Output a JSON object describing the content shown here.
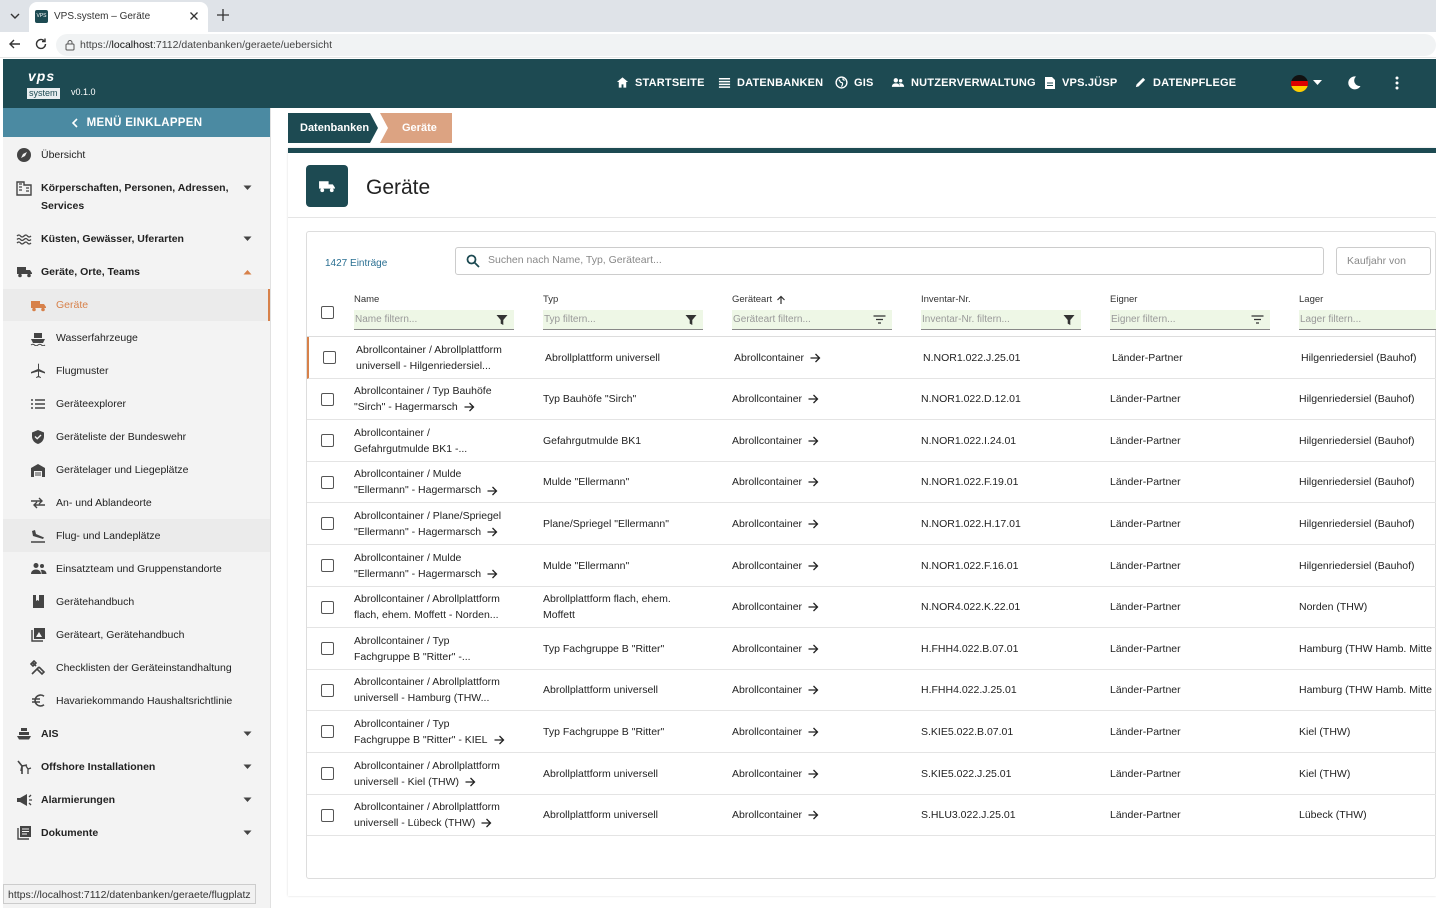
{
  "browser": {
    "tab_title": "VPS.system – Geräte",
    "favicon_text": "VPS",
    "url_prefix": "https://",
    "url_host": "localhost",
    "url_rest": ":7112/datenbanken/geraete/uebersicht",
    "status_url": "https://localhost:7112/datenbanken/geraete/flugplatz"
  },
  "app": {
    "logo_top": "vps",
    "logo_bottom": "system",
    "version": "v0.1.0",
    "brand_color": "#1d4a52",
    "accent_color": "#d7814a",
    "nav": [
      {
        "label": "STARTSEITE",
        "icon": "home-icon"
      },
      {
        "label": "DATENBANKEN",
        "icon": "list-icon"
      },
      {
        "label": "GIS",
        "icon": "globe-icon"
      },
      {
        "label": "NUTZERVERWALTUNG",
        "icon": "users-icon"
      },
      {
        "label": "VPS.JÜSP",
        "icon": "document-icon"
      },
      {
        "label": "DATENPFLEGE",
        "icon": "pencil-icon"
      }
    ]
  },
  "sidebar": {
    "collapse_label": "MENÜ EINKLAPPEN",
    "items": [
      {
        "label": "Übersicht",
        "icon": "compass-icon"
      },
      {
        "label": "Körperschaften, Personen, Adressen,",
        "label2": "Services",
        "icon": "building-icon"
      },
      {
        "label": "Küsten, Gewässer, Uferarten",
        "icon": "waves-icon"
      },
      {
        "label": "Geräte, Orte, Teams",
        "icon": "truck-icon"
      },
      {
        "label": "Geräte",
        "icon": "truck-icon"
      },
      {
        "label": "Wasserfahrzeuge",
        "icon": "boat-icon"
      },
      {
        "label": "Flugmuster",
        "icon": "plane-icon"
      },
      {
        "label": "Geräteexplorer",
        "icon": "list-icon"
      },
      {
        "label": "Geräteliste der Bundeswehr",
        "icon": "shield-icon"
      },
      {
        "label": "Gerätelager und Liegeplätze",
        "icon": "warehouse-icon"
      },
      {
        "label": "An- und Ablandeorte",
        "icon": "transfer-icon"
      },
      {
        "label": "Flug- und Landeplätze",
        "icon": "landing-icon"
      },
      {
        "label": "Einsatzteam und Gruppenstandorte",
        "icon": "group-icon"
      },
      {
        "label": "Gerätehandbuch",
        "icon": "book-icon"
      },
      {
        "label": "Geräteart, Gerätehandbuch",
        "icon": "image-book-icon"
      },
      {
        "label": "Checklisten der Geräteinstandhaltung",
        "icon": "tools-icon"
      },
      {
        "label": "Havariekommando Haushaltsrichtlinie",
        "icon": "euro-icon"
      },
      {
        "label": "AIS",
        "icon": "ship-icon"
      },
      {
        "label": "Offshore Installationen",
        "icon": "windfarm-icon"
      },
      {
        "label": "Alarmierungen",
        "icon": "megaphone-icon"
      },
      {
        "label": "Dokumente",
        "icon": "documents-icon"
      }
    ]
  },
  "breadcrumb": {
    "root": "Datenbanken",
    "current": "Geräte"
  },
  "page": {
    "title": "Geräte"
  },
  "table": {
    "count": "1427 Einträge",
    "search_placeholder": "Suchen nach Name, Typ, Geräteart...",
    "year_placeholder": "Kaufjahr von",
    "columns": [
      {
        "label": "Name",
        "filter": "Name filtern..."
      },
      {
        "label": "Typ",
        "filter": "Typ filtern..."
      },
      {
        "label": "Geräteart",
        "filter": "Geräteart filtern..."
      },
      {
        "label": "Inventar-Nr.",
        "filter": "Inventar-Nr. filtern..."
      },
      {
        "label": "Eigner",
        "filter": "Eigner filtern..."
      },
      {
        "label": "Lager",
        "filter": "Lager filtern..."
      }
    ],
    "rows": [
      {
        "name1": "Abrollcontainer / Abrollplattform",
        "name2": "universell - Hilgenriedersiel...",
        "name_arrow": false,
        "typ": "Abrollplattform universell",
        "typ2": "",
        "art": "Abrollcontainer",
        "inv": "N.NOR1.022.J.25.01",
        "eigner": "Länder-Partner",
        "lager": "Hilgenriedersiel (Bauhof)"
      },
      {
        "name1": "Abrollcontainer / Typ Bauhöfe",
        "name2": "\"Sirch\" - Hagermarsch",
        "name_arrow": true,
        "typ": "Typ Bauhöfe \"Sirch\"",
        "typ2": "",
        "art": "Abrollcontainer",
        "inv": "N.NOR1.022.D.12.01",
        "eigner": "Länder-Partner",
        "lager": "Hilgenriedersiel (Bauhof)"
      },
      {
        "name1": "Abrollcontainer /",
        "name2": "Gefahrgutmulde BK1 -...",
        "name_arrow": false,
        "typ": "Gefahrgutmulde BK1",
        "typ2": "",
        "art": "Abrollcontainer",
        "inv": "N.NOR1.022.I.24.01",
        "eigner": "Länder-Partner",
        "lager": "Hilgenriedersiel (Bauhof)"
      },
      {
        "name1": "Abrollcontainer / Mulde",
        "name2": "\"Ellermann\" - Hagermarsch",
        "name_arrow": true,
        "typ": "Mulde \"Ellermann\"",
        "typ2": "",
        "art": "Abrollcontainer",
        "inv": "N.NOR1.022.F.19.01",
        "eigner": "Länder-Partner",
        "lager": "Hilgenriedersiel (Bauhof)"
      },
      {
        "name1": "Abrollcontainer / Plane/Spriegel",
        "name2": "\"Ellermann\" - Hagermarsch",
        "name_arrow": true,
        "typ": "Plane/Spriegel \"Ellermann\"",
        "typ2": "",
        "art": "Abrollcontainer",
        "inv": "N.NOR1.022.H.17.01",
        "eigner": "Länder-Partner",
        "lager": "Hilgenriedersiel (Bauhof)"
      },
      {
        "name1": "Abrollcontainer / Mulde",
        "name2": "\"Ellermann\" - Hagermarsch",
        "name_arrow": true,
        "typ": "Mulde \"Ellermann\"",
        "typ2": "",
        "art": "Abrollcontainer",
        "inv": "N.NOR1.022.F.16.01",
        "eigner": "Länder-Partner",
        "lager": "Hilgenriedersiel (Bauhof)"
      },
      {
        "name1": "Abrollcontainer / Abrollplattform",
        "name2": "flach, ehem. Moffett - Norden...",
        "name_arrow": false,
        "typ": "Abrollplattform flach, ehem.",
        "typ2": "Moffett",
        "art": "Abrollcontainer",
        "inv": "N.NOR4.022.K.22.01",
        "eigner": "Länder-Partner",
        "lager": "Norden (THW)"
      },
      {
        "name1": "Abrollcontainer / Typ",
        "name2": "Fachgruppe B \"Ritter\" -...",
        "name_arrow": false,
        "typ": "Typ Fachgruppe B \"Ritter\"",
        "typ2": "",
        "art": "Abrollcontainer",
        "inv": "H.FHH4.022.B.07.01",
        "eigner": "Länder-Partner",
        "lager": "Hamburg (THW Hamb. Mitte"
      },
      {
        "name1": "Abrollcontainer / Abrollplattform",
        "name2": "universell - Hamburg (THW...",
        "name_arrow": false,
        "typ": "Abrollplattform universell",
        "typ2": "",
        "art": "Abrollcontainer",
        "inv": "H.FHH4.022.J.25.01",
        "eigner": "Länder-Partner",
        "lager": "Hamburg (THW Hamb. Mitte"
      },
      {
        "name1": "Abrollcontainer / Typ",
        "name2": "Fachgruppe B \"Ritter\" - KIEL",
        "name_arrow": true,
        "typ": "Typ Fachgruppe B \"Ritter\"",
        "typ2": "",
        "art": "Abrollcontainer",
        "inv": "S.KIE5.022.B.07.01",
        "eigner": "Länder-Partner",
        "lager": "Kiel (THW)"
      },
      {
        "name1": "Abrollcontainer / Abrollplattform",
        "name2": "universell - Kiel (THW)",
        "name_arrow": true,
        "typ": "Abrollplattform universell",
        "typ2": "",
        "art": "Abrollcontainer",
        "inv": "S.KIE5.022.J.25.01",
        "eigner": "Länder-Partner",
        "lager": "Kiel (THW)"
      },
      {
        "name1": "Abrollcontainer / Abrollplattform",
        "name2": "universell - Lübeck (THW)",
        "name_arrow": true,
        "typ": "Abrollplattform universell",
        "typ2": "",
        "art": "Abrollcontainer",
        "inv": "S.HLU3.022.J.25.01",
        "eigner": "Länder-Partner",
        "lager": "Lübeck (THW)"
      }
    ]
  }
}
